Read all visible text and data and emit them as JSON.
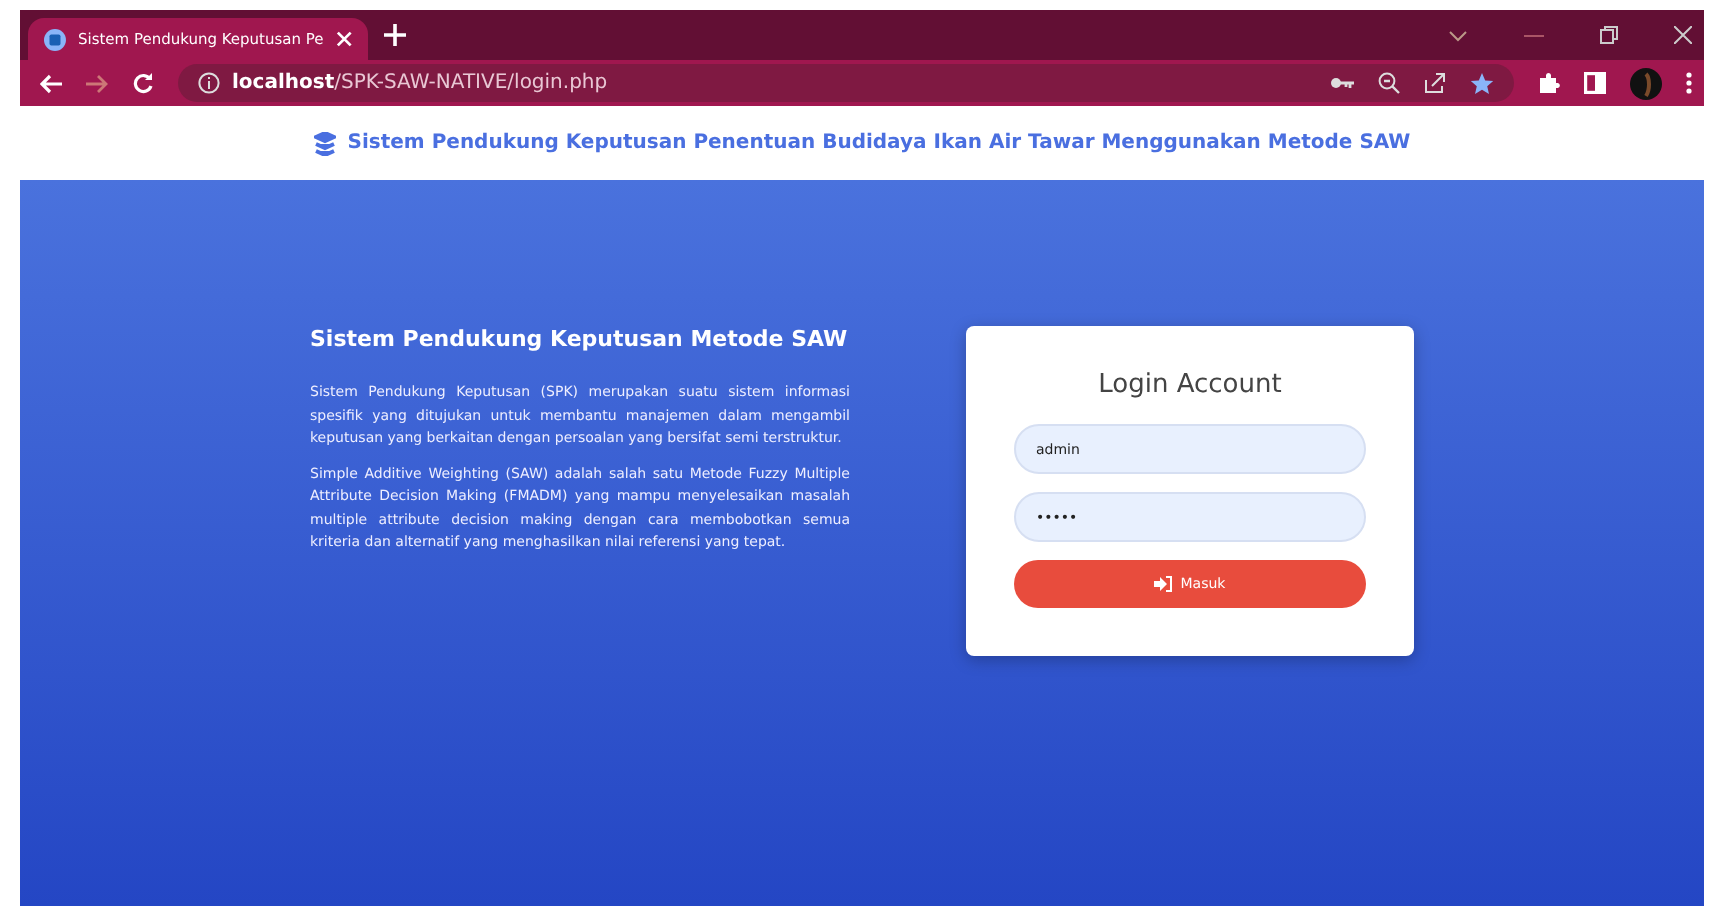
{
  "browser": {
    "tab_title": "Sistem Pendukung Keputusan Pe",
    "url_host": "localhost",
    "url_path": "/SPK-SAW-NATIVE/login.php"
  },
  "header": {
    "title": "Sistem Pendukung Keputusan Penentuan Budidaya Ikan Air Tawar Menggunakan Metode SAW"
  },
  "intro": {
    "heading": "Sistem Pendukung Keputusan Metode SAW",
    "paragraphs": [
      "Sistem Pendukung Keputusan (SPK) merupakan suatu sistem informasi spesifik yang ditujukan untuk membantu manajemen dalam mengambil keputusan yang berkaitan dengan persoalan yang bersifat semi terstruktur.",
      "Simple Additive Weighting (SAW) adalah salah satu Metode Fuzzy Multiple Attribute Decision Making (FMADM) yang mampu menyelesaikan masalah multiple attribute decision making dengan cara membobotkan semua kriteria dan alternatif yang menghasilkan nilai referensi yang tepat."
    ]
  },
  "login": {
    "title": "Login Account",
    "username": "admin",
    "password": "•••••",
    "button": "Masuk"
  }
}
